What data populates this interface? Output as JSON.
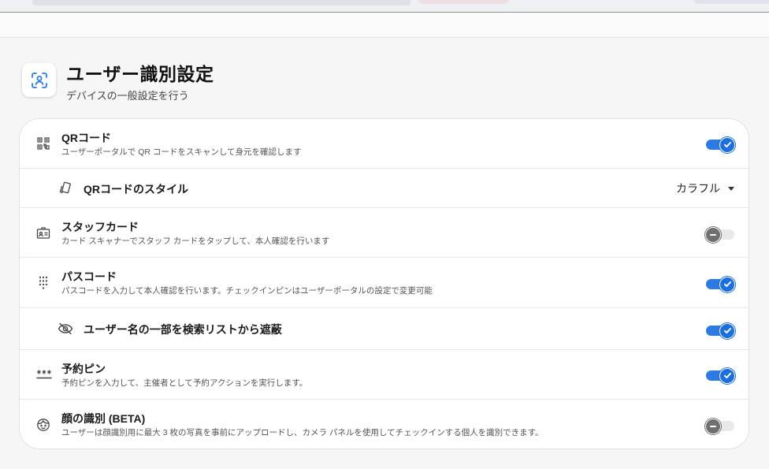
{
  "header": {
    "title": "ユーザー識別設定",
    "subtitle": "デバイスの一般設定を行う",
    "icon": "face-scan-icon",
    "accent_color": "#2c7be5"
  },
  "settings": [
    {
      "icon": "qr-code-icon",
      "title": "QRコード",
      "description": "ユーザーポータルで QR コードをスキャンして身元を確認します",
      "enabled": true
    },
    {
      "icon": "card-style-icon",
      "title": "QRコードのスタイル",
      "select_value": "カラフル"
    },
    {
      "icon": "id-badge-icon",
      "title": "スタッフカード",
      "description": "カード スキャナーでスタッフ カードをタップして、本人確認を行います",
      "enabled": false
    },
    {
      "icon": "keypad-icon",
      "title": "パスコード",
      "description": "パスコードを入力して本人確認を行います。チェックインピンはユーザーポータルの設定で変更可能",
      "enabled": true
    },
    {
      "icon": "eye-slash-icon",
      "title": "ユーザー名の一部を検索リストから遮蔽",
      "enabled": true
    },
    {
      "icon": "pin-asterisk-icon",
      "title": "予約ピン",
      "description": "予約ピンを入力して、主催者として予約アクションを実行します。",
      "enabled": true
    },
    {
      "icon": "face-icon",
      "title": "顔の識別 (BETA)",
      "description": "ユーザーは顔識別用に最大 3 枚の写真を事前にアップロードし、カメラ パネルを使用してチェックインする個人を識別できます。",
      "enabled": false
    }
  ]
}
